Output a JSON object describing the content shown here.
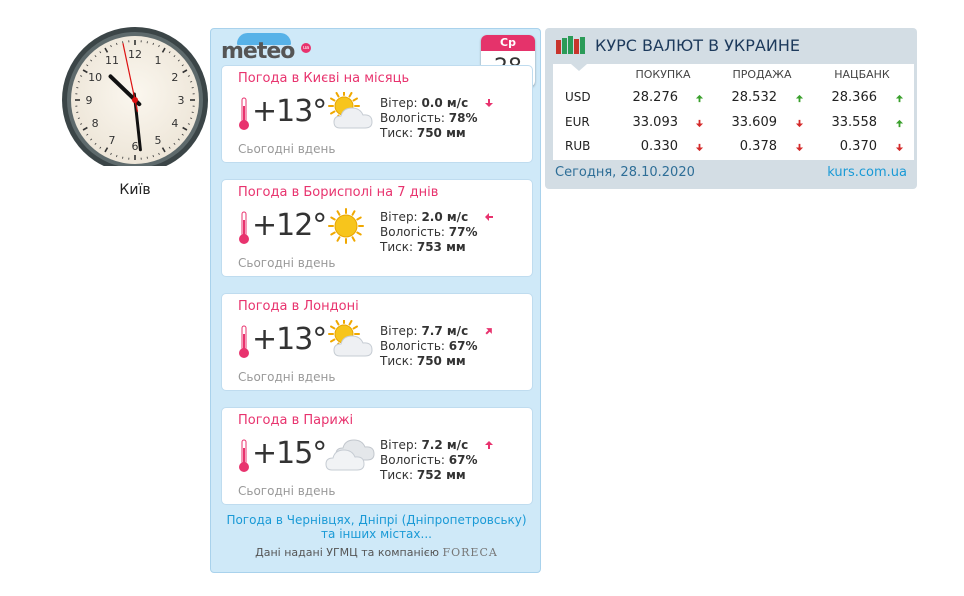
{
  "clock": {
    "city": "Київ",
    "time": "10:28:58",
    "numbers": [
      "12",
      "1",
      "2",
      "3",
      "4",
      "5",
      "6",
      "7",
      "8",
      "9",
      "10",
      "11"
    ]
  },
  "meteo": {
    "logo_text": "meteo",
    "logo_badge": "ua",
    "calendar": {
      "weekday": "Ср",
      "day": "28"
    },
    "cards": [
      {
        "title": "Погода в Києві на місяць",
        "temp": "+13°",
        "icon": "sun-cloud-icon",
        "wind_label": "Вітер:",
        "wind": "0.0 м/с",
        "wind_arrow": "down",
        "humidity_label": "Вологість:",
        "humidity": "78%",
        "pressure_label": "Тиск:",
        "pressure": "750 мм",
        "period": "Сьогодні вдень"
      },
      {
        "title": "Погода в Борисполі на 7 днів",
        "temp": "+12°",
        "icon": "sun-icon",
        "wind_label": "Вітер:",
        "wind": "2.0 м/с",
        "wind_arrow": "left",
        "humidity_label": "Вологість:",
        "humidity": "77%",
        "pressure_label": "Тиск:",
        "pressure": "753 мм",
        "period": "Сьогодні вдень"
      },
      {
        "title": "Погода в Лондоні",
        "temp": "+13°",
        "icon": "sun-cloud-icon",
        "wind_label": "Вітер:",
        "wind": "7.7 м/с",
        "wind_arrow": "up-right",
        "humidity_label": "Вологість:",
        "humidity": "67%",
        "pressure_label": "Тиск:",
        "pressure": "750 мм",
        "period": "Сьогодні вдень"
      },
      {
        "title": "Погода в Парижі",
        "temp": "+15°",
        "icon": "clouds-icon",
        "wind_label": "Вітер:",
        "wind": "7.2 м/с",
        "wind_arrow": "up",
        "humidity_label": "Вологість:",
        "humidity": "67%",
        "pressure_label": "Тиск:",
        "pressure": "752 мм",
        "period": "Сьогодні вдень"
      }
    ],
    "more_line1": "Погода в Чернівцях, Дніпрі (Дніпропетровську)",
    "more_line2": "та інших містах...",
    "source_text": "Дані надані УГМЦ та компанією",
    "source_brand": "FORECA"
  },
  "currency": {
    "title": "КУРС ВАЛЮТ В УКРАИНЕ",
    "headers": [
      "ПОКУПКА",
      "ПРОДАЖА",
      "НАЦБАНК"
    ],
    "rows": [
      {
        "code": "USD",
        "buy": "28.276",
        "buy_dir": "up",
        "sell": "28.532",
        "sell_dir": "up",
        "nbu": "28.366",
        "nbu_dir": "up"
      },
      {
        "code": "EUR",
        "buy": "33.093",
        "buy_dir": "down",
        "sell": "33.609",
        "sell_dir": "down",
        "nbu": "33.558",
        "nbu_dir": "up"
      },
      {
        "code": "RUB",
        "buy": "0.330",
        "buy_dir": "down",
        "sell": "0.378",
        "sell_dir": "down",
        "nbu": "0.370",
        "nbu_dir": "down"
      }
    ],
    "date": "Сегодня, 28.10.2020",
    "link": "kurs.com.ua",
    "colors": {
      "up": "#3aa02c",
      "down": "#d42a2a"
    }
  }
}
